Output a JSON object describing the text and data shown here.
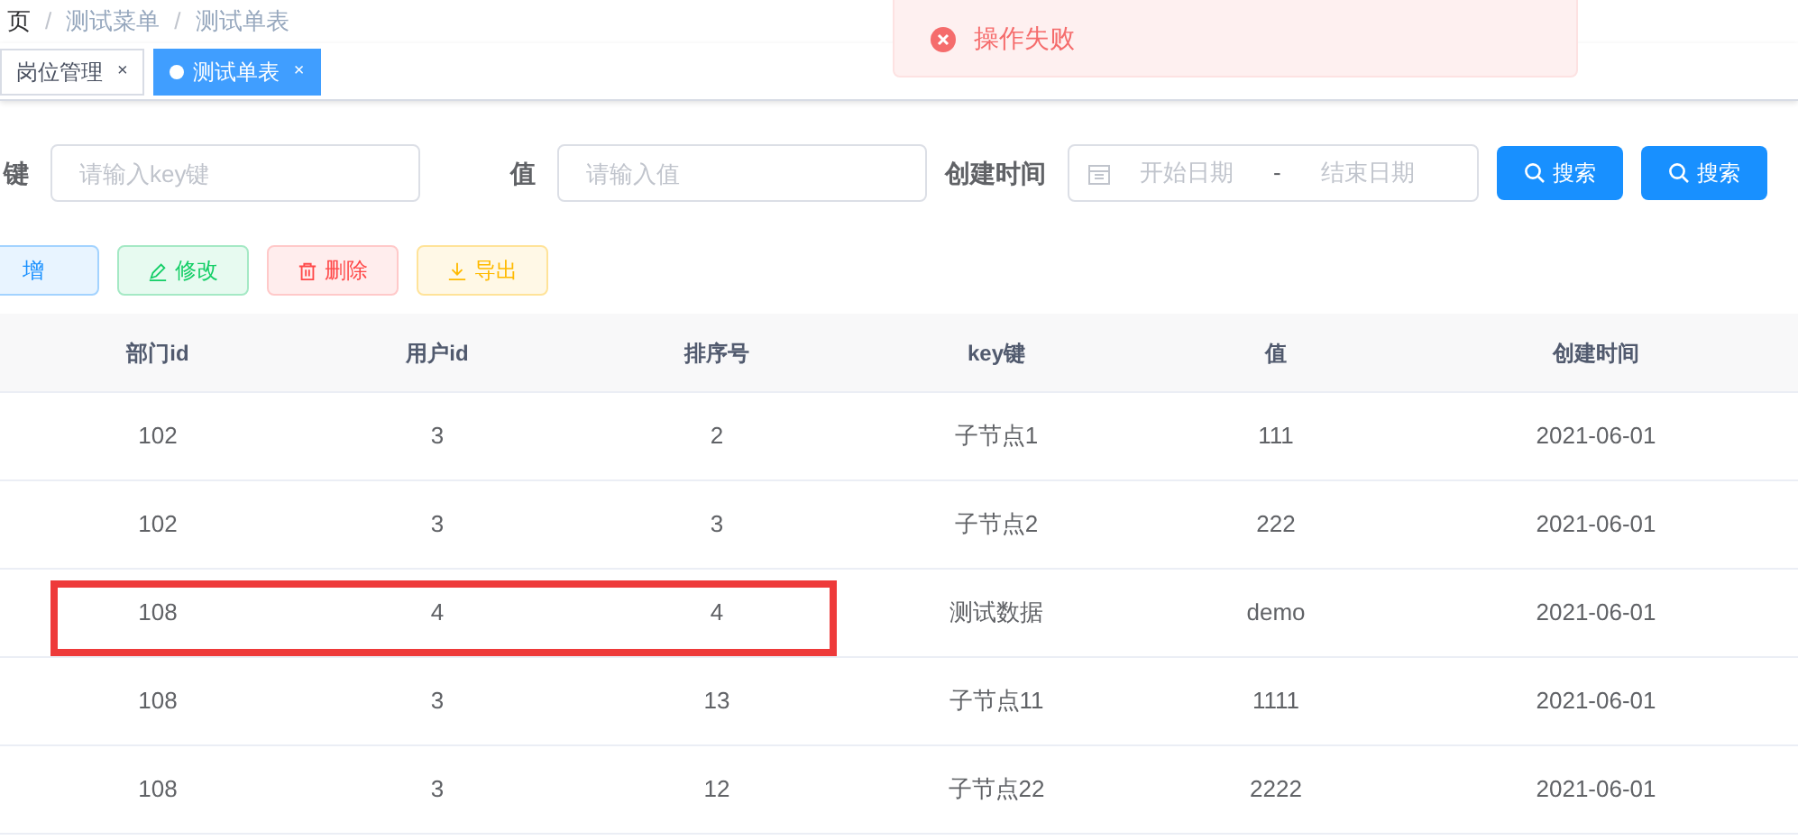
{
  "breadcrumb": {
    "separator": "/",
    "items": [
      "页",
      "测试菜单",
      "测试单表"
    ]
  },
  "tabs": [
    {
      "label": "岗位管理",
      "selected": false,
      "close": "×"
    },
    {
      "label": "测试单表",
      "selected": true,
      "close": "×"
    }
  ],
  "toast": {
    "kind": "error",
    "message": "操作失败"
  },
  "filters": [
    {
      "kind": "input",
      "label": "键",
      "placeholder": "请输入key键"
    },
    {
      "kind": "input",
      "label": "值",
      "placeholder": "请输入值"
    },
    {
      "kind": "daterange",
      "label": "创建时间",
      "start_placeholder": "开始日期",
      "separator": "-",
      "end_placeholder": "结束日期"
    }
  ],
  "search_buttons": [
    "搜索",
    "搜索"
  ],
  "actions": [
    {
      "kind": "primary",
      "label": "增"
    },
    {
      "kind": "success",
      "label": "修改"
    },
    {
      "kind": "danger",
      "label": "删除"
    },
    {
      "kind": "warning",
      "label": "导出"
    }
  ],
  "table": {
    "columns": [
      "部门id",
      "用户id",
      "排序号",
      "key键",
      "值",
      "创建时间"
    ],
    "rows": [
      {
        "cells": [
          "102",
          "3",
          "2",
          "子节点1",
          "111",
          "2021-06-01"
        ],
        "highlighted": false
      },
      {
        "cells": [
          "102",
          "3",
          "3",
          "子节点2",
          "222",
          "2021-06-01"
        ],
        "highlighted": false
      },
      {
        "cells": [
          "108",
          "4",
          "4",
          "测试数据",
          "demo",
          "2021-06-01"
        ],
        "highlighted": true
      },
      {
        "cells": [
          "108",
          "3",
          "13",
          "子节点11",
          "1111",
          "2021-06-01"
        ],
        "highlighted": false
      },
      {
        "cells": [
          "108",
          "3",
          "12",
          "子节点22",
          "2222",
          "2021-06-01"
        ],
        "highlighted": false
      }
    ]
  }
}
